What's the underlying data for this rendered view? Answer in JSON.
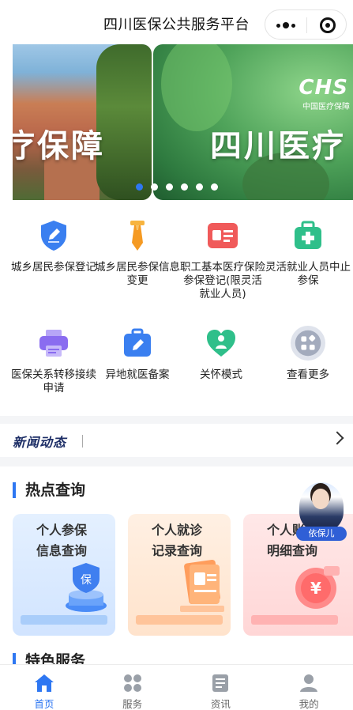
{
  "header": {
    "title": "四川医保公共服务平台"
  },
  "banner": {
    "left_text": "疗保障",
    "right_logo": "CHS",
    "right_logo_sub": "中国医疗保障",
    "right_text": "四川医疗"
  },
  "services": [
    {
      "label": "城乡居民参保登记",
      "icon": "shield-pen-icon",
      "color": "#3a7ff0"
    },
    {
      "label": "城乡居民参保信息变更",
      "icon": "tie-icon",
      "color": "#f59a23"
    },
    {
      "label": "职工基本医疗保险参保登记(限灵活就业人员)",
      "icon": "card-icon",
      "color": "#f05a5a"
    },
    {
      "label": "灵活就业人员中止参保",
      "icon": "medkit-icon",
      "color": "#2fbf8a"
    },
    {
      "label": "医保关系转移接续申请",
      "icon": "printer-icon",
      "color": "#8a6cf0"
    },
    {
      "label": "异地就医备案",
      "icon": "briefcase-pen-icon",
      "color": "#3a7ff0"
    },
    {
      "label": "关怀模式",
      "icon": "heart-person-icon",
      "color": "#2fbf8a"
    },
    {
      "label": "查看更多",
      "icon": "grid-more-icon",
      "color": "#9aa3b8"
    }
  ],
  "news": {
    "title_a": "新闻",
    "title_b": "动态"
  },
  "hot": {
    "title": "热点查询",
    "cards": [
      {
        "line1": "个人参保",
        "line2": "信息查询"
      },
      {
        "line1": "个人就诊",
        "line2": "记录查询"
      },
      {
        "line1": "个人账",
        "line2": "明细查询"
      }
    ]
  },
  "assistant": {
    "label": "依保儿"
  },
  "feature": {
    "title": "特色服务"
  },
  "tabbar": [
    {
      "label": "首页",
      "active": true
    },
    {
      "label": "服务",
      "active": false
    },
    {
      "label": "资讯",
      "active": false
    },
    {
      "label": "我的",
      "active": false
    }
  ],
  "colors": {
    "accent": "#2e77f2",
    "inactive": "#9aa0a8"
  }
}
